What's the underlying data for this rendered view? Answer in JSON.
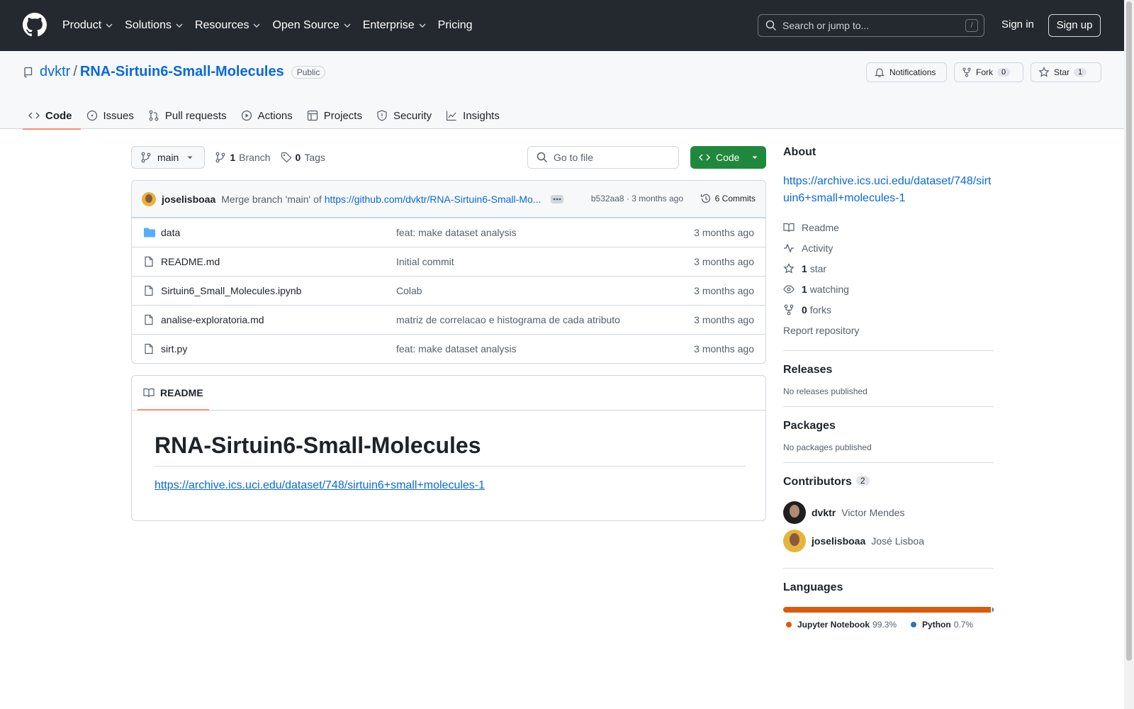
{
  "header": {
    "nav": [
      "Product",
      "Solutions",
      "Resources",
      "Open Source",
      "Enterprise",
      "Pricing"
    ],
    "search_placeholder": "Search or jump to...",
    "search_shortcut": "/",
    "sign_in": "Sign in",
    "sign_up": "Sign up"
  },
  "repo": {
    "owner": "dvktr",
    "separator": "/",
    "name": "RNA-Sirtuin6-Small-Molecules",
    "visibility": "Public",
    "notifications_label": "Notifications",
    "fork_label": "Fork",
    "fork_count": "0",
    "star_label": "Star",
    "star_count": "1",
    "tabs": [
      "Code",
      "Issues",
      "Pull requests",
      "Actions",
      "Projects",
      "Security",
      "Insights"
    ]
  },
  "toolbar": {
    "branch": "main",
    "branch_count": "1",
    "branch_label": "Branch",
    "tag_count": "0",
    "tag_label": "Tags",
    "goto_placeholder": "Go to file",
    "code_label": "Code"
  },
  "commit": {
    "author": "joselisboaa",
    "message": "Merge branch 'main' of",
    "message_link": "https://github.com/dvktr/RNA-Sirtuin6-Small-Mo...",
    "hash_time": "b532aa8 · 3 months ago",
    "commits_label": "6 Commits"
  },
  "files": [
    {
      "name": "data",
      "type": "folder",
      "message": "feat: make dataset analysis",
      "time": "3 months ago"
    },
    {
      "name": "README.md",
      "type": "file",
      "message": "Initial commit",
      "time": "3 months ago"
    },
    {
      "name": "Sirtuin6_Small_Molecules.ipynb",
      "type": "file",
      "message": "Colab",
      "time": "3 months ago"
    },
    {
      "name": "analise-exploratoria.md",
      "type": "file",
      "message": "matriz de correlacao e histograma de cada atributo",
      "time": "3 months ago"
    },
    {
      "name": "sirt.py",
      "type": "file",
      "message": "feat: make dataset analysis",
      "time": "3 months ago"
    }
  ],
  "readme": {
    "tab_label": "README",
    "heading": "RNA-Sirtuin6-Small-Molecules",
    "link": "https://archive.ics.uci.edu/dataset/748/sirtuin6+small+molecules-1"
  },
  "about": {
    "title": "About",
    "link": "https://archive.ics.uci.edu/dataset/748/sirtuin6+small+molecules-1",
    "readme": "Readme",
    "activity": "Activity",
    "stars_count": "1",
    "stars_label": "star",
    "watching_count": "1",
    "watching_label": "watching",
    "forks_count": "0",
    "forks_label": "forks",
    "report": "Report repository"
  },
  "releases": {
    "title": "Releases",
    "text": "No releases published"
  },
  "packages": {
    "title": "Packages",
    "text": "No packages published"
  },
  "contributors": {
    "title": "Contributors",
    "count": "2",
    "list": [
      {
        "login": "dvktr",
        "name": "Victor Mendes"
      },
      {
        "login": "joselisboaa",
        "name": "José Lisboa"
      }
    ]
  },
  "languages": {
    "title": "Languages",
    "list": [
      {
        "name": "Jupyter Notebook",
        "percent": "99.3%",
        "value": 99.3,
        "color": "#DA5B0B"
      },
      {
        "name": "Python",
        "percent": "0.7%",
        "value": 0.7,
        "color": "#3572A5"
      }
    ]
  }
}
